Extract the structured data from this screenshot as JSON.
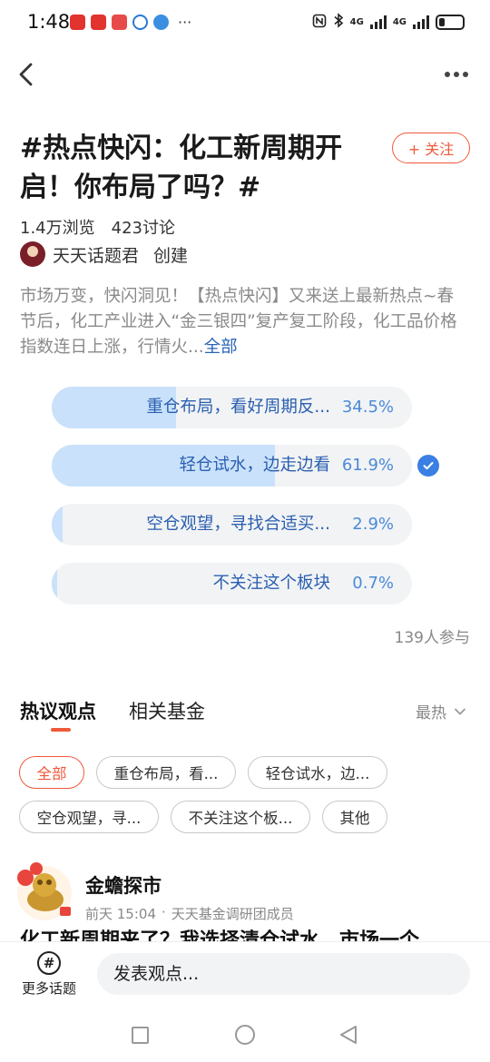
{
  "status_bar": {
    "time": "1:48",
    "more": "···",
    "network_label_1": "4G",
    "network_label_2": "4G"
  },
  "topic": {
    "title": "#热点快闪：化工新周期开启！你布局了吗？#",
    "follow_label": "+ 关注",
    "views": "1.4万浏览",
    "discussions": "423讨论",
    "creator_name": "天天话题君",
    "creator_role": "创建",
    "description": "市场万变，快闪洞见！【热点快闪】又来送上最新热点~春节后，化工产业进入“金三银四”复产复工阶段，化工品价格指数连日上涨，行情火...",
    "description_more": "全部"
  },
  "poll": {
    "options": [
      {
        "label": "重仓布局，看好周期反...",
        "percent": "34.5%",
        "fraction": 0.345,
        "selected": false
      },
      {
        "label": "轻仓试水，边走边看",
        "percent": "61.9%",
        "fraction": 0.619,
        "selected": true
      },
      {
        "label": "空仓观望，寻找合适买...",
        "percent": "2.9%",
        "fraction": 0.029,
        "selected": false
      },
      {
        "label": "不关注这个板块",
        "percent": "0.7%",
        "fraction": 0.007,
        "selected": false
      }
    ],
    "participants": "139人参与"
  },
  "tabs": {
    "items": [
      "热议观点",
      "相关基金"
    ],
    "active_index": 0,
    "sort_label": "最热"
  },
  "filters": {
    "chips": [
      "全部",
      "重仓布局，看...",
      "轻仓试水，边...",
      "空仓观望，寻...",
      "不关注这个板...",
      "其他"
    ],
    "active_index": 0
  },
  "post": {
    "author": "金蟾探市",
    "time": "前天 15:04",
    "separator": "·",
    "badge": "天天基金调研团成员",
    "snippet": "化工新周期来了？我选择清仓试水，市场一个"
  },
  "bottom_bar": {
    "more_topics_label": "更多话题",
    "comment_placeholder": "发表观点..."
  },
  "colors": {
    "accent": "#ef5a3b",
    "poll_fill": "#c9e1fb",
    "poll_text": "#2a5fb0",
    "check": "#3a7fe3"
  }
}
